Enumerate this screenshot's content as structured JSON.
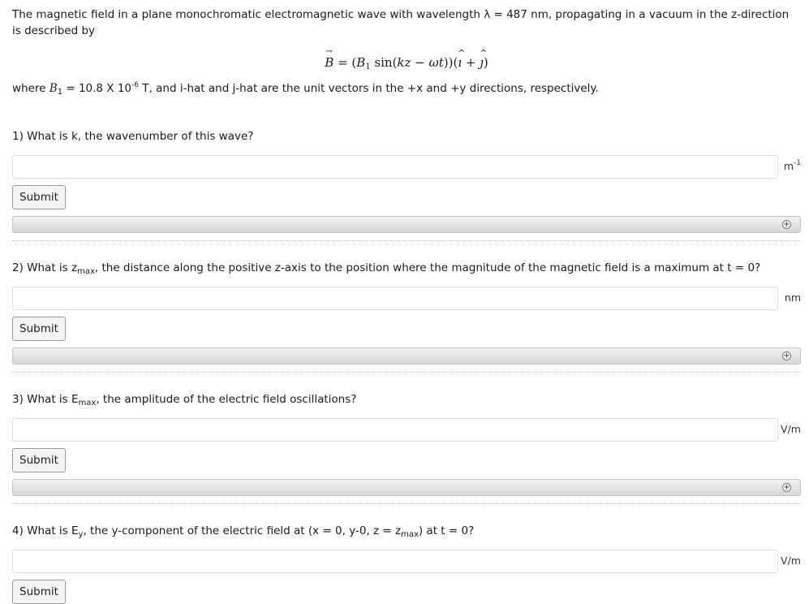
{
  "intro": {
    "line1": "The magnetic field in a plane monochromatic electromagnetic wave with wavelength λ = 487 nm, propagating in a vacuum in the z-direction is described by",
    "where_prefix": "where ",
    "b1_symbol": "B",
    "b1_sub": "1",
    "b1_value": " = 10.8 X 10",
    "b1_exp": "-6",
    "where_suffix": " T, and i-hat and j-hat are the unit vectors in the +x and +y directions, respectively."
  },
  "equation": {
    "lhs": "B",
    "eq_open": " = (",
    "b": "B",
    "b_sub": "1",
    "sin": " sin(",
    "kz": "kz",
    "minus": " − ",
    "wt": "ωt",
    "mid": "))(",
    "i": "ı",
    "plus": " + ",
    "j": "ȷ",
    "close": ")"
  },
  "questions": [
    {
      "num": "1) ",
      "pre": "What is k, the wavenumber of this wave?",
      "unit": "m",
      "unit_sup": "-1",
      "submit": "Submit",
      "help": "+"
    },
    {
      "num": "2) ",
      "pre": "What is z",
      "sub": "max",
      "post": ", the distance along the positive z-axis to the position where the magnitude of the magnetic field is a maximum at t = 0?",
      "unit": "nm",
      "submit": "Submit",
      "help": "+"
    },
    {
      "num": "3) ",
      "pre": "What is E",
      "sub": "max",
      "post": ", the amplitude of the electric field oscillations?",
      "unit": "V/m",
      "submit": "Submit",
      "help": "+"
    },
    {
      "num": "4) ",
      "pre": "What is E",
      "sub": "y",
      "post": ", the y-component of the electric field at (x = 0, y-0, z = z",
      "sub2": "max",
      "post2": ") at t = 0?",
      "unit": "V/m",
      "submit": "Submit"
    }
  ]
}
